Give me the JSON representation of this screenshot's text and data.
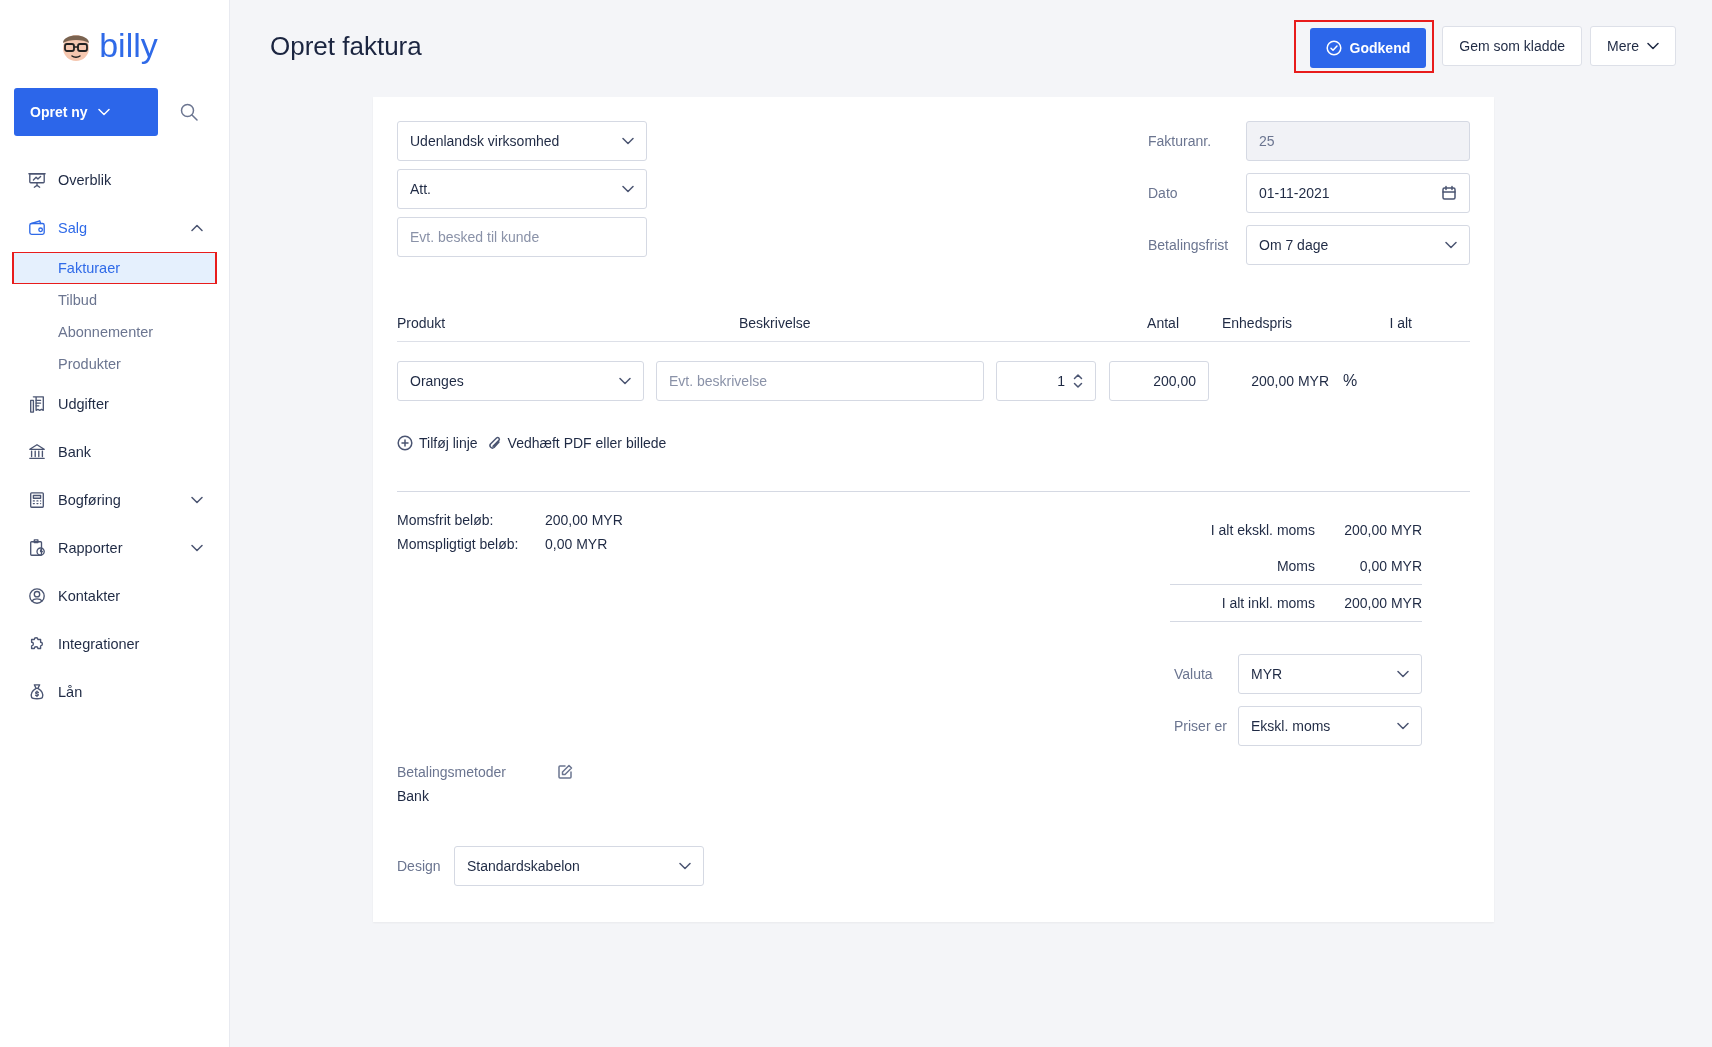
{
  "sidebar": {
    "logo_text": "billy",
    "create_button": {
      "label": "Opret ny"
    },
    "nav": [
      {
        "label": "Overblik",
        "selected": false
      },
      {
        "label": "Salg",
        "selected": true,
        "expanded": true,
        "children": [
          {
            "label": "Fakturaer",
            "selected": true,
            "highlighted": true
          },
          {
            "label": "Tilbud",
            "selected": false,
            "highlighted": false
          },
          {
            "label": "Abonnementer",
            "selected": false,
            "highlighted": false
          },
          {
            "label": "Produkter",
            "selected": false,
            "highlighted": false
          }
        ]
      },
      {
        "label": "Udgifter",
        "selected": false
      },
      {
        "label": "Bank",
        "selected": false
      },
      {
        "label": "Bogføring",
        "selected": false,
        "expanded": false
      },
      {
        "label": "Rapporter",
        "selected": false,
        "expanded": false
      },
      {
        "label": "Kontakter",
        "selected": false
      },
      {
        "label": "Integrationer",
        "selected": false
      },
      {
        "label": "Lån",
        "selected": false
      }
    ]
  },
  "header": {
    "title": "Opret faktura",
    "buttons": [
      {
        "label": "Godkend",
        "kind": "primary",
        "highlighted": true
      },
      {
        "label": "Gem som kladde",
        "kind": "secondary",
        "highlighted": false
      },
      {
        "label": "Mere",
        "kind": "dropdown",
        "highlighted": false
      }
    ]
  },
  "invoice": {
    "left_fields": [
      {
        "kind": "select",
        "value": "Udenlandsk virksomhed"
      },
      {
        "kind": "select",
        "value": "Att."
      },
      {
        "kind": "input",
        "placeholder": "Evt. besked til kunde"
      }
    ],
    "right_fields": [
      {
        "label": "Fakturanr.",
        "kind": "readonly",
        "value": "25"
      },
      {
        "label": "Dato",
        "kind": "date",
        "value": "01-11-2021"
      },
      {
        "label": "Betalingsfrist",
        "kind": "select",
        "value": "Om 7 dage"
      }
    ],
    "columns": [
      "Produkt",
      "Beskrivelse",
      "Antal",
      "Enhedspris",
      "I alt"
    ],
    "lines": [
      {
        "product": "Oranges",
        "description_placeholder": "Evt. beskrivelse",
        "quantity": "1",
        "unit_price": "200,00",
        "total": "200,00 MYR",
        "vat_toggle": "%"
      }
    ],
    "actions": [
      {
        "label": "Tilføj linje"
      },
      {
        "label": "Vedhæft PDF eller billede"
      }
    ],
    "vat_summary": [
      {
        "label": "Momsfrit beløb:",
        "value": "200,00 MYR"
      },
      {
        "label": "Momspligtigt beløb:",
        "value": "0,00 MYR"
      }
    ],
    "totals": [
      {
        "kind": "subtotal",
        "label": "I alt ekskl. moms",
        "value": "200,00 MYR"
      },
      {
        "kind": "tax",
        "label": "Moms",
        "value": "0,00 MYR"
      },
      {
        "kind": "total",
        "label": "I alt inkl. moms",
        "value": "200,00 MYR"
      }
    ],
    "settings": [
      {
        "label": "Valuta",
        "value": "MYR"
      },
      {
        "label": "Priser er",
        "value": "Ekskl. moms"
      }
    ],
    "payment_methods": {
      "label": "Betalingsmetoder",
      "value": "Bank"
    },
    "design": {
      "label": "Design",
      "value": "Standardskabelon"
    }
  }
}
